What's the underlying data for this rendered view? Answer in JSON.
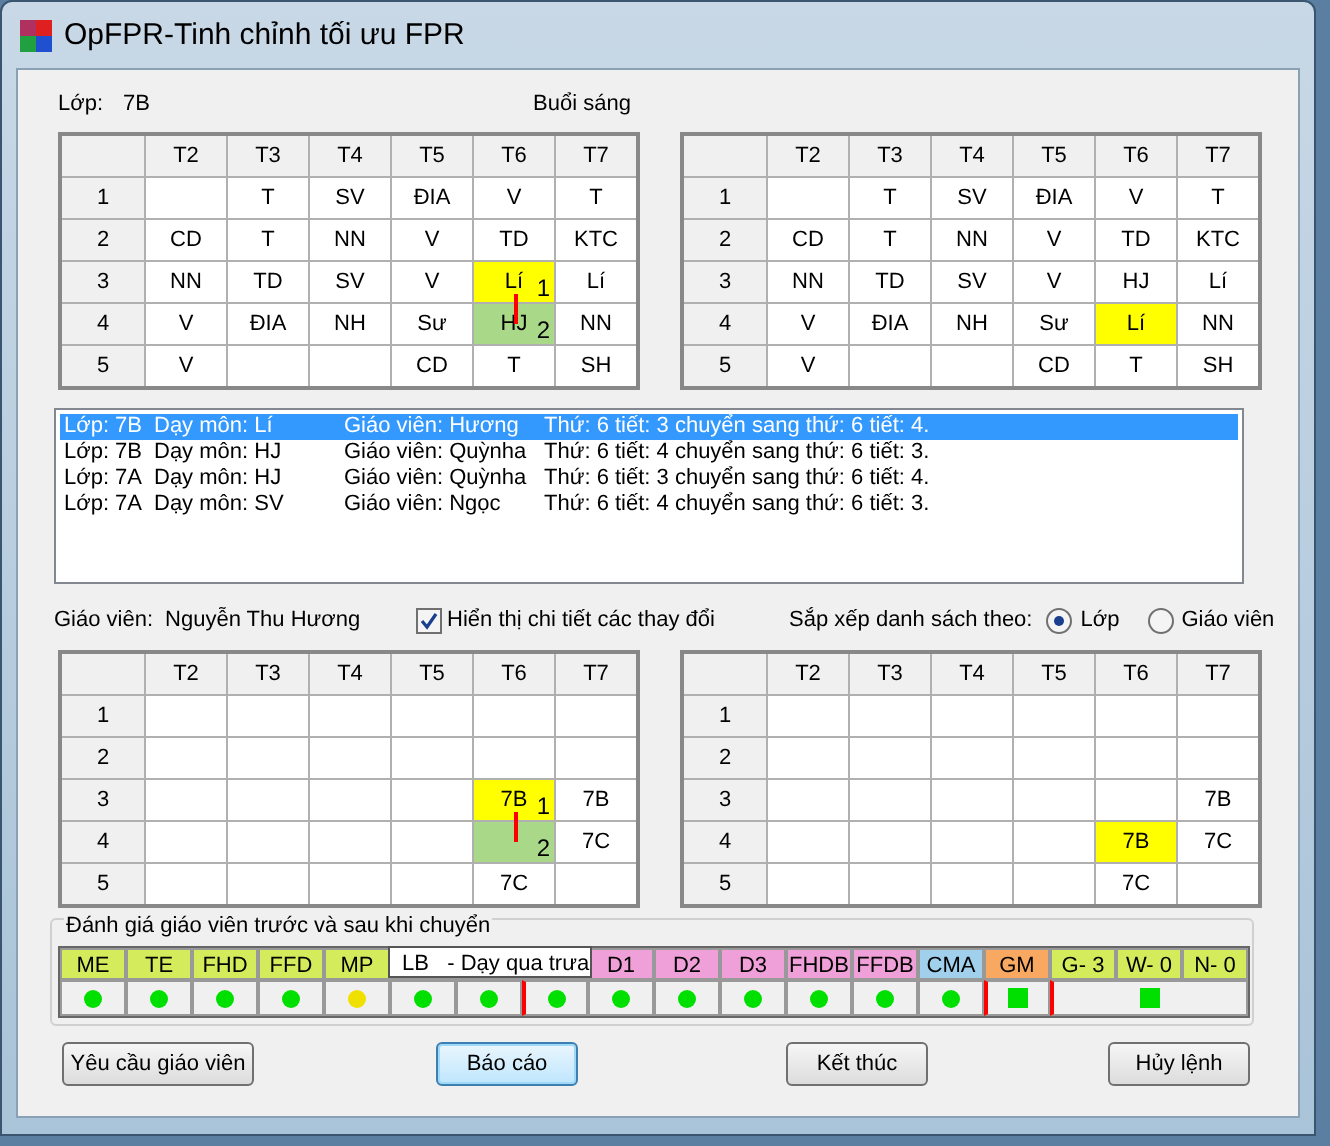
{
  "window": {
    "title": "OpFPR-Tinh chỉnh tối ưu FPR"
  },
  "class_section": {
    "label": "Lớp:",
    "value": "7B",
    "session": "Buổi sáng"
  },
  "class_grids": [
    {
      "columns": [
        "T2",
        "T3",
        "T4",
        "T5",
        "T6",
        "T7"
      ],
      "rows": [
        {
          "period": "1",
          "cells": [
            null,
            "T",
            "SV",
            "ĐIA",
            "V",
            "T"
          ]
        },
        {
          "period": "2",
          "cells": [
            "CD",
            "T",
            "NN",
            "V",
            "TD",
            "KTC"
          ]
        },
        {
          "period": "3",
          "cells": [
            "NN",
            "TD",
            "SV",
            "V",
            {
              "text": "Lí",
              "color": "#ffff00",
              "badge": "1",
              "move_line": true
            },
            "Lí"
          ]
        },
        {
          "period": "4",
          "cells": [
            "V",
            "ĐIA",
            "NH",
            "Sư",
            {
              "text": "HJ",
              "color": "#a8d888",
              "badge": "2"
            },
            "NN"
          ]
        },
        {
          "period": "5",
          "cells": [
            "V",
            null,
            null,
            "CD",
            "T",
            "SH"
          ]
        }
      ]
    },
    {
      "columns": [
        "T2",
        "T3",
        "T4",
        "T5",
        "T6",
        "T7"
      ],
      "rows": [
        {
          "period": "1",
          "cells": [
            null,
            "T",
            "SV",
            "ĐIA",
            "V",
            "T"
          ]
        },
        {
          "period": "2",
          "cells": [
            "CD",
            "T",
            "NN",
            "V",
            "TD",
            "KTC"
          ]
        },
        {
          "period": "3",
          "cells": [
            "NN",
            "TD",
            "SV",
            "V",
            "HJ",
            "Lí"
          ]
        },
        {
          "period": "4",
          "cells": [
            "V",
            "ĐIA",
            "NH",
            "Sư",
            {
              "text": "Lí",
              "color": "#ffff00"
            },
            "NN"
          ]
        },
        {
          "period": "5",
          "cells": [
            "V",
            null,
            null,
            "CD",
            "T",
            "SH"
          ]
        }
      ]
    }
  ],
  "changes_list": {
    "items": [
      {
        "selected": true,
        "fields": [
          "Lớp: 7B",
          "Dạy môn: Lí",
          "Giáo viên: Hương",
          "Thứ: 6 tiết: 3 chuyển sang thứ: 6 tiết: 4."
        ]
      },
      {
        "selected": false,
        "fields": [
          "Lớp: 7B",
          "Dạy môn: HJ",
          "Giáo viên: Quỳnha",
          "Thứ: 6 tiết: 4 chuyển sang thứ: 6 tiết: 3."
        ]
      },
      {
        "selected": false,
        "fields": [
          "Lớp: 7A",
          "Dạy môn: HJ",
          "Giáo viên: Quỳnha",
          "Thứ: 6 tiết: 3 chuyển sang thứ: 6 tiết: 4."
        ]
      },
      {
        "selected": false,
        "fields": [
          "Lớp: 7A",
          "Dạy môn: SV",
          "Giáo viên: Ngọc",
          "Thứ: 6 tiết: 4 chuyển sang thứ: 6 tiết: 3."
        ]
      }
    ]
  },
  "teacher": {
    "label": "Giáo viên:",
    "value": "Nguyễn Thu Hương"
  },
  "show_details": {
    "label": "Hiển thị chi tiết các thay đổi",
    "checked": true
  },
  "sort": {
    "label": "Sắp xếp danh sách theo:",
    "options": [
      {
        "label": "Lớp",
        "selected": true
      },
      {
        "label": "Giáo viên",
        "selected": false
      }
    ]
  },
  "teacher_grids": [
    {
      "columns": [
        "T2",
        "T3",
        "T4",
        "T5",
        "T6",
        "T7"
      ],
      "rows": [
        {
          "period": "1",
          "cells": [
            null,
            null,
            null,
            null,
            null,
            null
          ]
        },
        {
          "period": "2",
          "cells": [
            null,
            null,
            null,
            null,
            null,
            null
          ]
        },
        {
          "period": "3",
          "cells": [
            null,
            null,
            null,
            null,
            {
              "text": "7B",
              "color": "#ffff00",
              "badge": "1",
              "move_line": true
            },
            "7B"
          ]
        },
        {
          "period": "4",
          "cells": [
            null,
            null,
            null,
            null,
            {
              "color": "#a8d888",
              "badge": "2"
            },
            "7C"
          ]
        },
        {
          "period": "5",
          "cells": [
            null,
            null,
            null,
            null,
            "7C",
            null
          ]
        }
      ]
    },
    {
      "columns": [
        "T2",
        "T3",
        "T4",
        "T5",
        "T6",
        "T7"
      ],
      "rows": [
        {
          "period": "1",
          "cells": [
            null,
            null,
            null,
            null,
            null,
            null
          ]
        },
        {
          "period": "2",
          "cells": [
            null,
            null,
            null,
            null,
            null,
            null
          ]
        },
        {
          "period": "3",
          "cells": [
            null,
            null,
            null,
            null,
            null,
            "7B"
          ]
        },
        {
          "period": "4",
          "cells": [
            null,
            null,
            null,
            null,
            {
              "text": "7B",
              "color": "#ffff00"
            },
            "7C"
          ]
        },
        {
          "period": "5",
          "cells": [
            null,
            null,
            null,
            null,
            "7C",
            null
          ]
        }
      ]
    }
  ],
  "evaluation": {
    "title": "Đánh giá giáo viên trước và sau khi chuyển",
    "tooltip": "LB   - Dạy qua trưa",
    "criteria": [
      {
        "labels": [
          "ME"
        ],
        "color": "#d4ec5c",
        "status": {
          "kind": "dot",
          "color": "#00e000"
        }
      },
      {
        "labels": [
          "TE"
        ],
        "color": "#d4ec5c",
        "status": {
          "kind": "dot",
          "color": "#00e000"
        }
      },
      {
        "labels": [
          "FHD"
        ],
        "color": "#d4ec5c",
        "status": {
          "kind": "dot",
          "color": "#00e000"
        }
      },
      {
        "labels": [
          "FFD"
        ],
        "color": "#d4ec5c",
        "status": {
          "kind": "dot",
          "color": "#00e000"
        }
      },
      {
        "labels": [
          "MP"
        ],
        "color": "#d4ec5c",
        "status": {
          "kind": "dot",
          "color": "#f0e000"
        }
      },
      {
        "status": {
          "kind": "dot",
          "color": "#00e000"
        }
      },
      {
        "status": {
          "kind": "dot",
          "color": "#00e000"
        }
      },
      {
        "status": {
          "kind": "dot",
          "color": "#00e000"
        },
        "separator": true
      },
      {
        "labels": [
          "D1"
        ],
        "color": "#f0a0d8",
        "status": {
          "kind": "dot",
          "color": "#00e000"
        }
      },
      {
        "labels": [
          "D2"
        ],
        "color": "#f0a0d8",
        "status": {
          "kind": "dot",
          "color": "#00e000"
        }
      },
      {
        "labels": [
          "D3"
        ],
        "color": "#f0a0d8",
        "status": {
          "kind": "dot",
          "color": "#00e000"
        }
      },
      {
        "labels": [
          "FHDB"
        ],
        "color": "#f0a0d8",
        "status": {
          "kind": "dot",
          "color": "#00e000"
        }
      },
      {
        "labels": [
          "FFDB"
        ],
        "color": "#f0a0d8",
        "status": {
          "kind": "dot",
          "color": "#00e000"
        }
      },
      {
        "labels": [
          "CMA"
        ],
        "color": "#a0d0ec",
        "status": {
          "kind": "dot",
          "color": "#00e000"
        }
      },
      {
        "labels": [
          "GM"
        ],
        "color": "#f8a860",
        "status": {
          "kind": "square",
          "color": "#00e000"
        },
        "separator": true
      },
      {
        "labels": [
          "G- 3",
          "W- 0",
          "N- 0"
        ],
        "color": "#d4ec5c",
        "status": {
          "kind": "square",
          "color": "#00e000"
        },
        "separator": true
      }
    ]
  },
  "buttons": [
    {
      "label": "Yêu cầu giáo viên",
      "focused": false
    },
    {
      "label": "Báo cáo",
      "focused": true
    },
    {
      "label": "Kết thúc",
      "focused": false
    },
    {
      "label": "Hủy lệnh",
      "focused": false
    }
  ]
}
